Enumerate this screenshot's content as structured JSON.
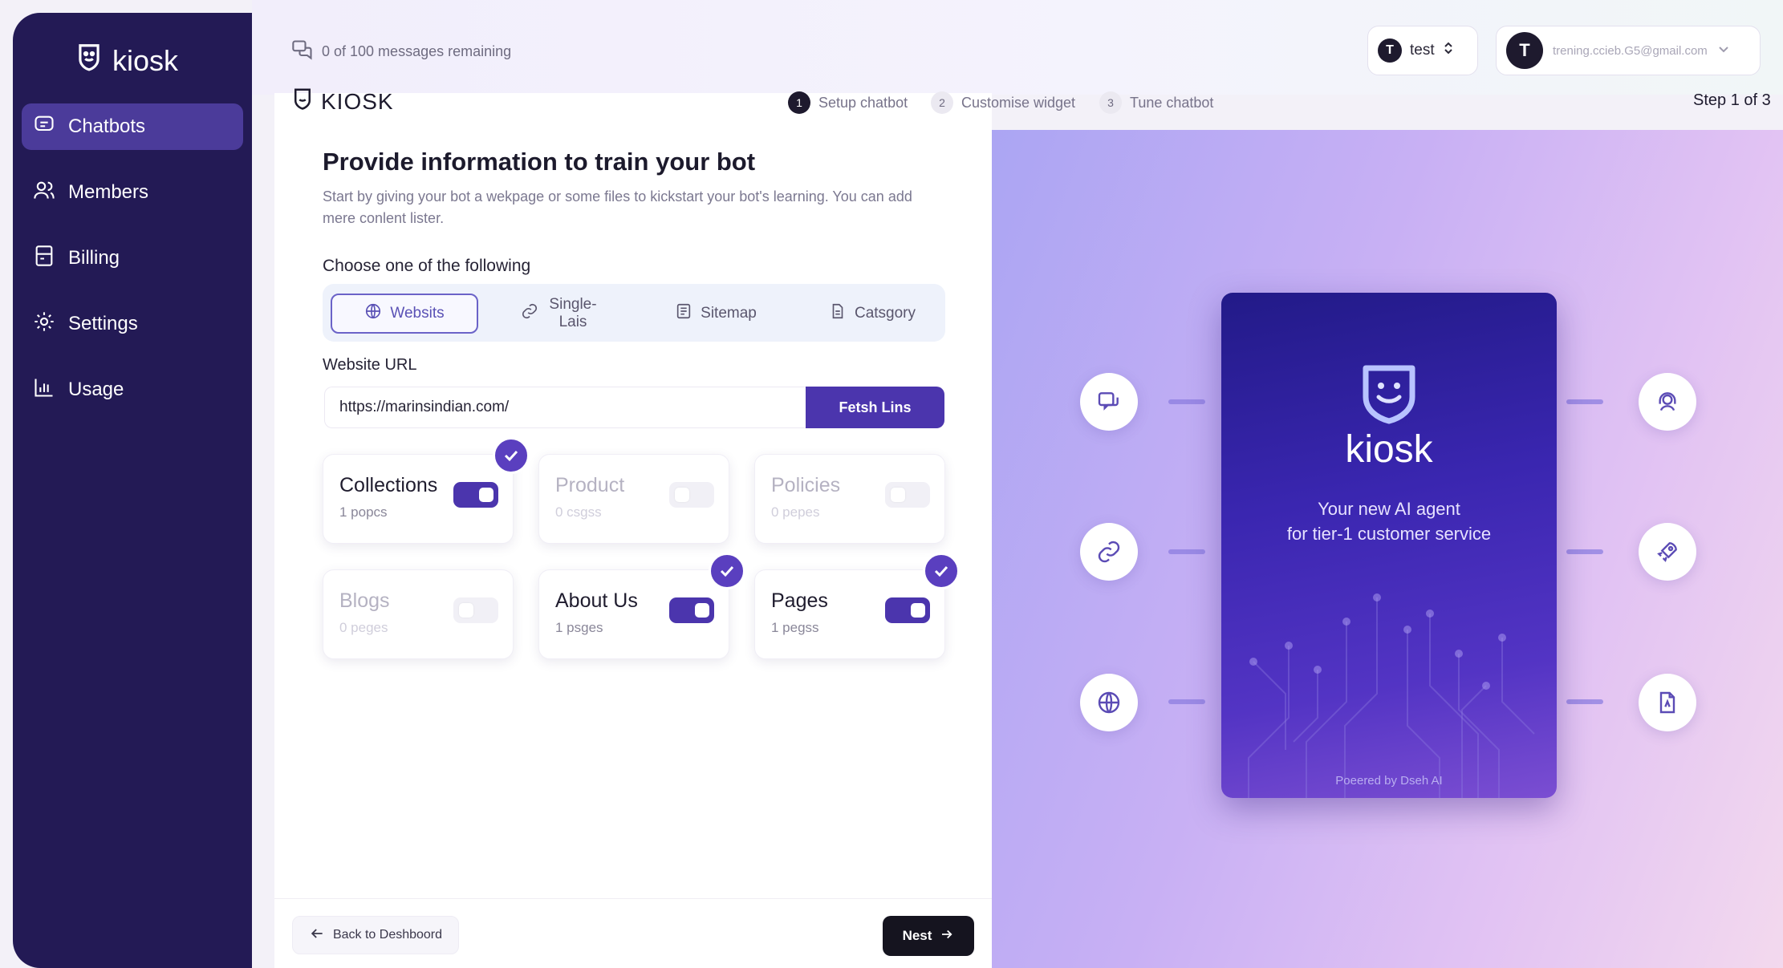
{
  "app": {
    "brand": "kiosk"
  },
  "sidebar": {
    "items": [
      {
        "label": "Chatbots",
        "icon": "chatbot-icon",
        "active": true
      },
      {
        "label": "Members",
        "icon": "members-icon"
      },
      {
        "label": "Billing",
        "icon": "billing-icon"
      },
      {
        "label": "Settings",
        "icon": "settings-icon"
      },
      {
        "label": "Usage",
        "icon": "usage-icon"
      }
    ]
  },
  "topbar": {
    "messages": "0 of 100 messages remaining",
    "workspace": {
      "initial": "T",
      "name": "test"
    },
    "account": {
      "initial": "T",
      "email": "trening.ccieb.G5@gmail.com"
    }
  },
  "wizard": {
    "brand": "KIOSK",
    "steps": [
      {
        "num": "1",
        "label": "Setup chatbot",
        "done": true
      },
      {
        "num": "2",
        "label": "Customise widget"
      },
      {
        "num": "3",
        "label": "Tune chatbot"
      }
    ],
    "step_count": "Step 1 of 3"
  },
  "form": {
    "title": "Provide information to train your bot",
    "subtitle": "Start by giving your bot a wekpage or some files to kickstart your bot's learning. You can add mere conlent lister.",
    "choose_label": "Choose one of the following",
    "tabs": [
      {
        "label": "Websits",
        "icon": "globe-icon",
        "active": true
      },
      {
        "label": "Single-Lais",
        "icon": "link-icon"
      },
      {
        "label": "Sitemap",
        "icon": "sitemap-icon"
      },
      {
        "label": "Catsgory",
        "icon": "category-icon"
      }
    ],
    "url_label": "Website URL",
    "url_value": "https://marinsindian.com/",
    "fetch_label": "Fetsh Lins",
    "cards": [
      {
        "name": "Collections",
        "count": "1 popcs",
        "enabled": true
      },
      {
        "name": "Product",
        "count": "0 csgss",
        "enabled": false
      },
      {
        "name": "Policies",
        "count": "0 pepes",
        "enabled": false
      },
      {
        "name": "Blogs",
        "count": "0 peges",
        "enabled": false
      },
      {
        "name": "About Us",
        "count": "1 psges",
        "enabled": true
      },
      {
        "name": "Pages",
        "count": "1 pegss",
        "enabled": true
      }
    ],
    "back_label": "Back to Deshboord",
    "next_label": "Nest"
  },
  "hero": {
    "brand": "kiosk",
    "tagline_line1": "Your new AI agent",
    "tagline_line2": "for tier-1 customer service",
    "powered_by": "Poeered by Dseh AI",
    "left_icons": [
      "chat-icon",
      "link-icon",
      "globe-icon"
    ],
    "right_icons": [
      "support-agent-icon",
      "rocket-icon",
      "document-icon"
    ]
  },
  "colors": {
    "sidebar": "#231a55",
    "accent": "#4b35ad",
    "active_nav": "#4b3b9a",
    "next_button": "#15141f"
  }
}
